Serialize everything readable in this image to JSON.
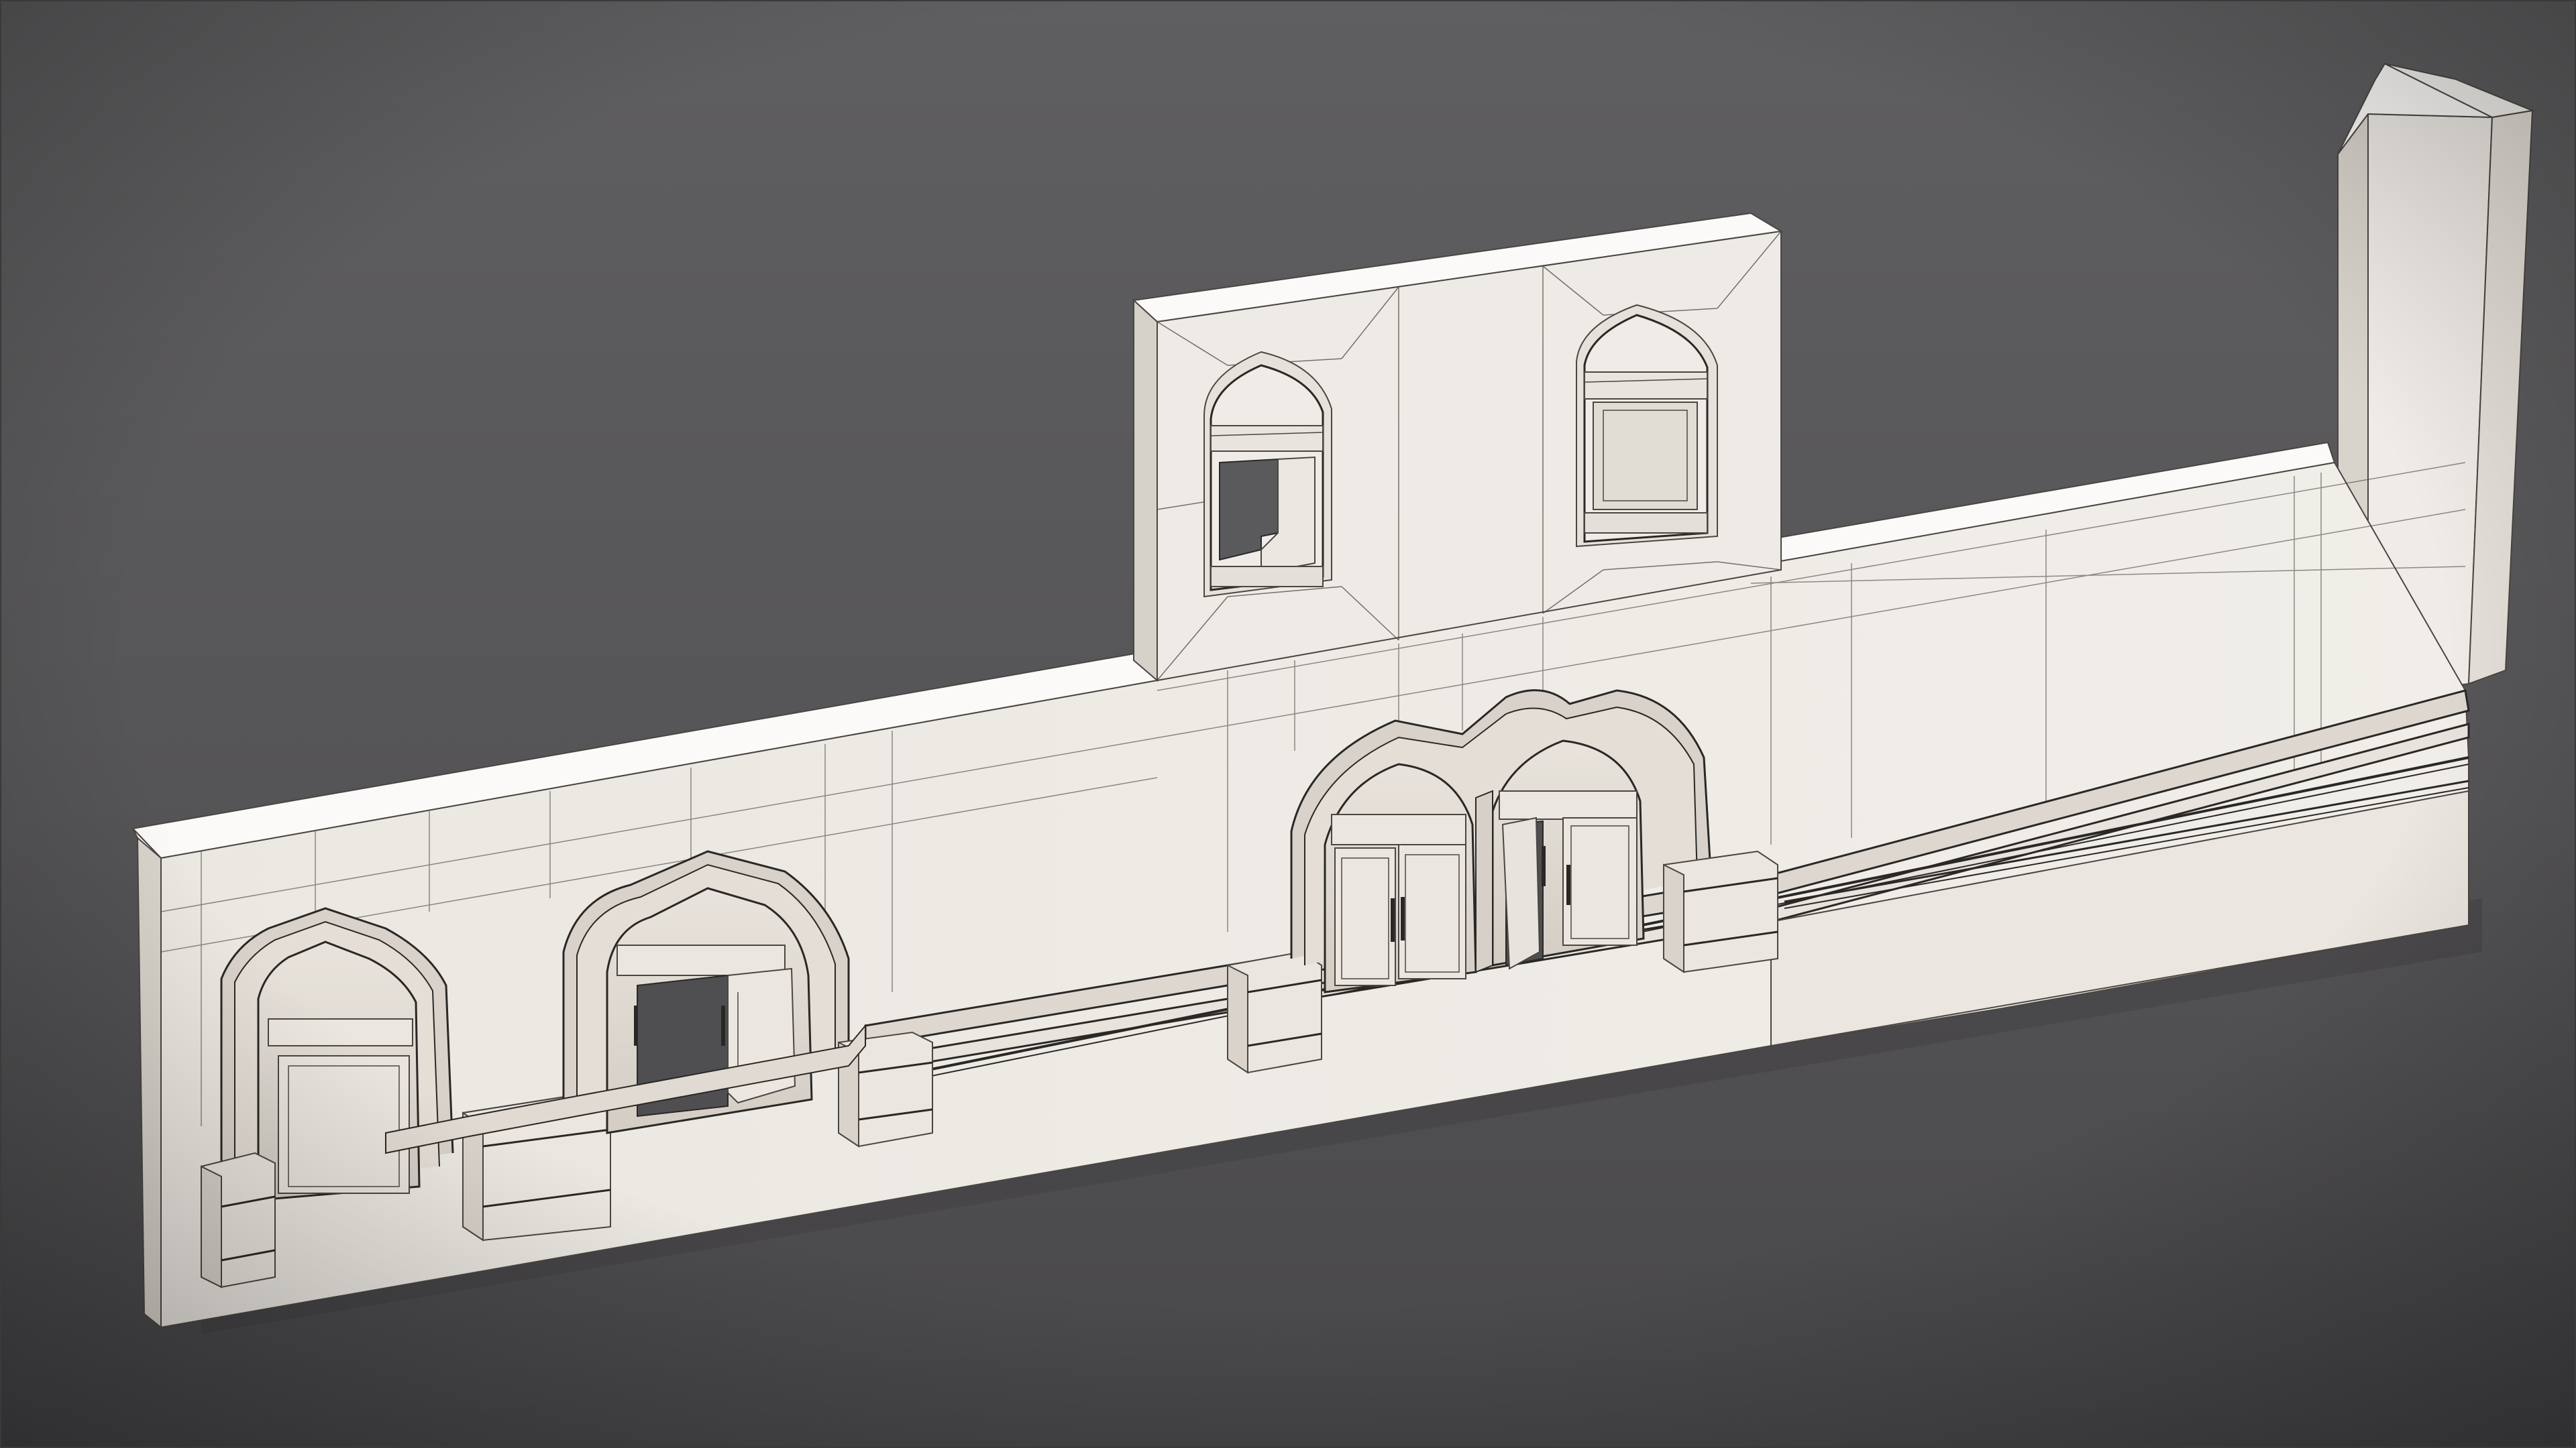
{
  "scene": {
    "subject": "",
    "render_mode": "wireframe-on-shaded",
    "colors": {
      "background_top": "#5c5b5d",
      "background_bottom": "#4a494b",
      "wall_face": "#ece8e2",
      "wall_top": "#fbfaf8",
      "wall_side": "#d9d4cc",
      "arch_reveal": "#e3ded6",
      "shadow": "#3a393b",
      "wire": "#4a4642",
      "molding_dark": "#2a2826"
    },
    "elements": {
      "arches_lower": 2,
      "arches_center_double": 2,
      "upper_windows": 2,
      "pilasters": 5,
      "tower": 1
    }
  }
}
